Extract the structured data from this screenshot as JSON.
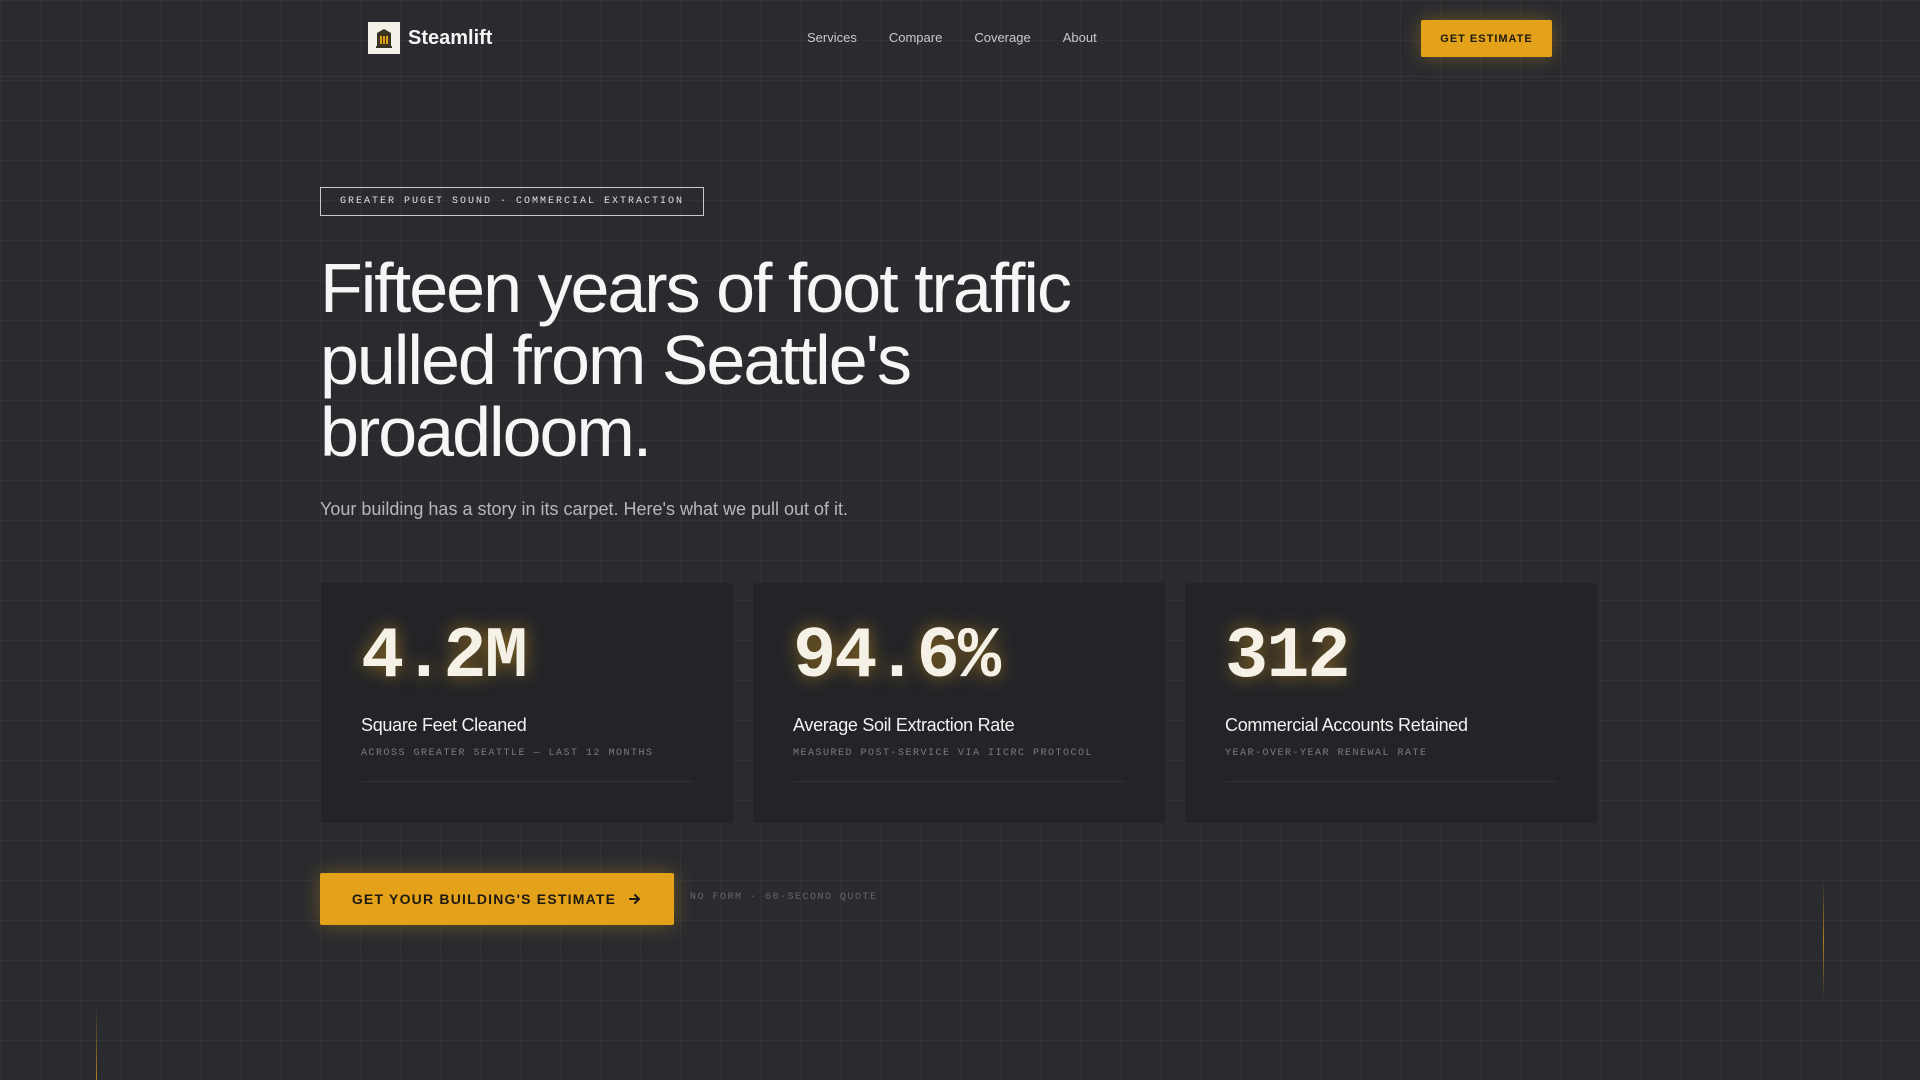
{
  "nav": {
    "brand": "Steamlift",
    "logo_icon": "building-icon",
    "links": [
      "Services",
      "Compare",
      "Coverage",
      "About"
    ],
    "cta_label": "GET ESTIMATE"
  },
  "hero": {
    "tag": "GREATER PUGET SOUND · COMMERCIAL EXTRACTION",
    "headline": "Fifteen years of foot traffic pulled from Seattle's broadloom.",
    "subtitle": "Your building has a story in its carpet. Here's what we pull out of it."
  },
  "stats": [
    {
      "value": "4.2M",
      "label": "Square Feet Cleaned",
      "desc": "ACROSS GREATER SEATTLE — LAST 12 MONTHS"
    },
    {
      "value": "94.6%",
      "label": "Average Soil Extraction Rate",
      "desc": "MEASURED POST-SERVICE VIA IICRC PROTOCOL"
    },
    {
      "value": "312",
      "label": "Commercial Accounts Retained",
      "desc": "YEAR-OVER-YEAR RENEWAL RATE"
    }
  ],
  "cta": {
    "label": "GET YOUR BUILDING'S ESTIMATE",
    "icon": "arrow-right-icon",
    "note": "NO FORM · 60-SECOND QUOTE"
  },
  "colors": {
    "background": "#2a2b2f",
    "accent": "#e3a21a",
    "card": "#232428"
  }
}
